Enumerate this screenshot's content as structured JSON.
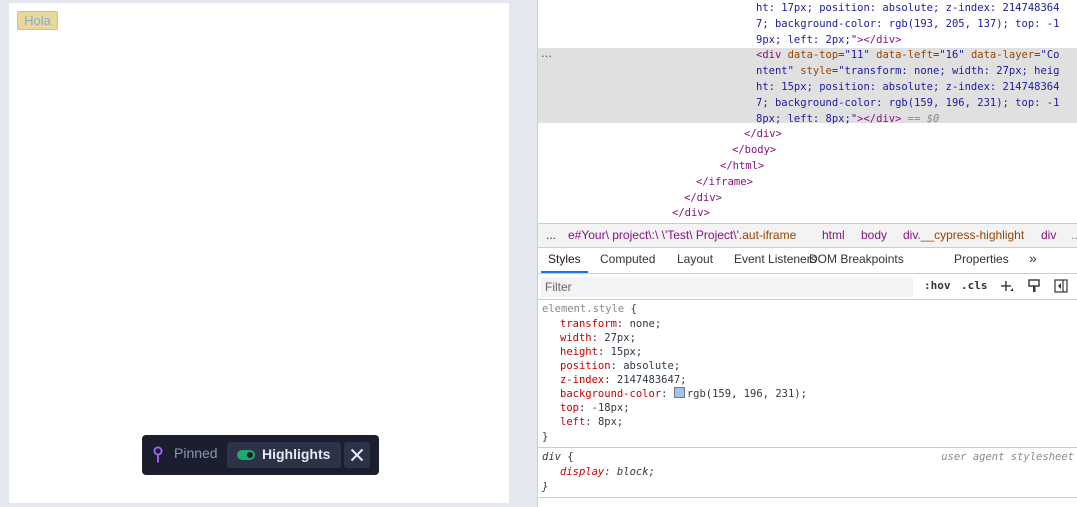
{
  "aut": {
    "hola_label": "Hola"
  },
  "pinned_bar": {
    "pinned_label": "Pinned",
    "highlights_label": "Highlights",
    "icons": {
      "pin": "pin-icon",
      "toggle": "toggle-icon",
      "close": "close-icon"
    },
    "colors": {
      "bar_bg": "#1b1e2e",
      "toggle_on": "#1fa971",
      "pin": "#a365ff"
    }
  },
  "elements_tree": {
    "lines": [
      {
        "indent": 0,
        "parts": [
          [
            "val",
            "ht: 17px; position: absolute; z-index: 214748364"
          ]
        ]
      },
      {
        "indent": 0,
        "parts": [
          [
            "val",
            "7; background-color: rgb(193, 205, 137); top: -1"
          ]
        ]
      },
      {
        "indent": 0,
        "parts": [
          [
            "val",
            "9px; left: 2px;\""
          ],
          [
            "tag",
            ">"
          ],
          [
            "tag",
            "</div>"
          ]
        ]
      },
      {
        "indent": 0,
        "parts": [
          [
            "tag",
            "<div "
          ],
          [
            "attr",
            "data-top"
          ],
          [
            "plain",
            "="
          ],
          [
            "val",
            "\"11\" "
          ],
          [
            "attr",
            "data-left"
          ],
          [
            "plain",
            "="
          ],
          [
            "val",
            "\"16\" "
          ],
          [
            "attr",
            "data-layer"
          ],
          [
            "plain",
            "="
          ],
          [
            "val",
            "\"Co"
          ]
        ]
      },
      {
        "indent": 0,
        "parts": [
          [
            "val",
            "ntent\" "
          ],
          [
            "attr",
            "style"
          ],
          [
            "plain",
            "="
          ],
          [
            "val",
            "\"transform: none; width: 27px; heig"
          ]
        ]
      },
      {
        "indent": 0,
        "parts": [
          [
            "val",
            "ht: 15px; position: absolute; z-index: 214748364"
          ]
        ]
      },
      {
        "indent": 0,
        "parts": [
          [
            "val",
            "7; background-color: rgb(159, 196, 231); top: -1"
          ]
        ]
      },
      {
        "indent": 0,
        "parts": [
          [
            "val",
            "8px; left: 8px;\""
          ],
          [
            "tag",
            ">"
          ],
          [
            "tag",
            "</div>"
          ],
          [
            "dim",
            " == $0"
          ]
        ]
      },
      {
        "indent": 1,
        "parts": [
          [
            "tag",
            "</div>"
          ]
        ]
      },
      {
        "indent": 2,
        "parts": [
          [
            "tag",
            "</body>"
          ]
        ]
      },
      {
        "indent": 3,
        "parts": [
          [
            "tag",
            "</html>"
          ]
        ]
      },
      {
        "indent": 4,
        "parts": [
          [
            "tag",
            "</iframe>"
          ]
        ]
      },
      {
        "indent": 5,
        "parts": [
          [
            "tag",
            "</div>"
          ]
        ]
      },
      {
        "indent": 6,
        "parts": [
          [
            "tag",
            "</div>"
          ]
        ]
      }
    ],
    "ellipsis": "…"
  },
  "breadcrumbs": {
    "ellipsis": "...",
    "items": [
      {
        "prefix": "e#Your\\ project\\:\\ \\'Test\\ Project\\'",
        "suffix": ".aut-iframe"
      },
      {
        "prefix": "html",
        "suffix": ""
      },
      {
        "prefix": "body",
        "suffix": ""
      },
      {
        "prefix": "div",
        "suffix": ".__cypress-highlight"
      },
      {
        "prefix": "div",
        "suffix": ""
      }
    ],
    "more": "..."
  },
  "tabs": [
    "Styles",
    "Computed",
    "Layout",
    "Event Listeners",
    "DOM Breakpoints",
    "Properties"
  ],
  "tabs_more": "»",
  "filter": {
    "placeholder": "Filter",
    "hov": ":hov",
    "cls": ".cls",
    "icons": [
      "add-rule-icon",
      "paint-icon",
      "toggle-sidebar-icon"
    ]
  },
  "element_style": {
    "selector": "element.style",
    "open": " {",
    "declarations": [
      {
        "prop": "transform",
        "value": "none"
      },
      {
        "prop": "width",
        "value": "27px"
      },
      {
        "prop": "height",
        "value": "15px"
      },
      {
        "prop": "position",
        "value": "absolute"
      },
      {
        "prop": "z-index",
        "value": "2147483647"
      },
      {
        "prop": "background-color",
        "value": "rgb(159, 196, 231)",
        "swatch": "#9fc4e7"
      },
      {
        "prop": "top",
        "value": "-18px"
      },
      {
        "prop": "left",
        "value": "8px"
      }
    ],
    "close": "}"
  },
  "ua_rule": {
    "selector": "div",
    "open": " {",
    "source": "user agent stylesheet",
    "declarations": [
      {
        "prop": "display",
        "value": "block"
      }
    ],
    "close": "}"
  }
}
